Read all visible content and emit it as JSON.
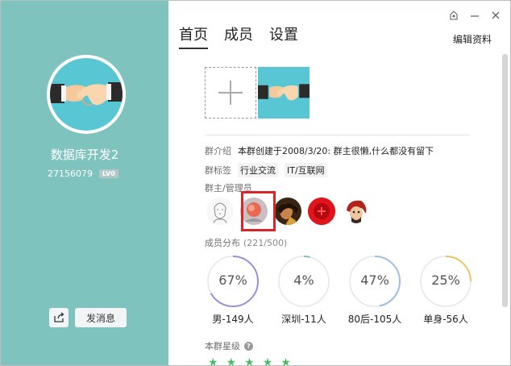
{
  "window": {
    "controls": [
      "skin-icon",
      "minimize-icon",
      "close-icon"
    ]
  },
  "group": {
    "name": "数据库开发2",
    "id": "27156079",
    "level": "LV0",
    "send_message": "发消息"
  },
  "tabs": [
    {
      "label": "首页",
      "active": true
    },
    {
      "label": "成员",
      "active": false
    },
    {
      "label": "设置",
      "active": false
    }
  ],
  "edit_label": "编辑资料",
  "intro": {
    "label": "群介绍",
    "value": "本群创建于2008/3/20:  群主很懒,什么都没有留下"
  },
  "tags": {
    "label": "群标签",
    "items": [
      "行业交流",
      "IT/互联网"
    ]
  },
  "admins": {
    "label": "群主/管理员",
    "count": 5,
    "selected_index": 1
  },
  "distribution": {
    "label": "成员分布",
    "sub": "(221/500)",
    "items": [
      {
        "percent": "67%",
        "value": 0.67,
        "label": "男-149人",
        "color": "#9b8fd6"
      },
      {
        "percent": "4%",
        "value": 0.04,
        "label": "深圳-11人",
        "color": "#7fc3bf"
      },
      {
        "percent": "47%",
        "value": 0.47,
        "label": "80后-105人",
        "color": "#9ebfe0"
      },
      {
        "percent": "25%",
        "value": 0.25,
        "label": "单身-56人",
        "color": "#f0c266"
      }
    ]
  },
  "rating": {
    "label": "本群星级",
    "stars": 5
  },
  "colors": {
    "left_panel": "#7fc3bf",
    "star": "#4cbb6a",
    "selection": "#d9242a"
  }
}
